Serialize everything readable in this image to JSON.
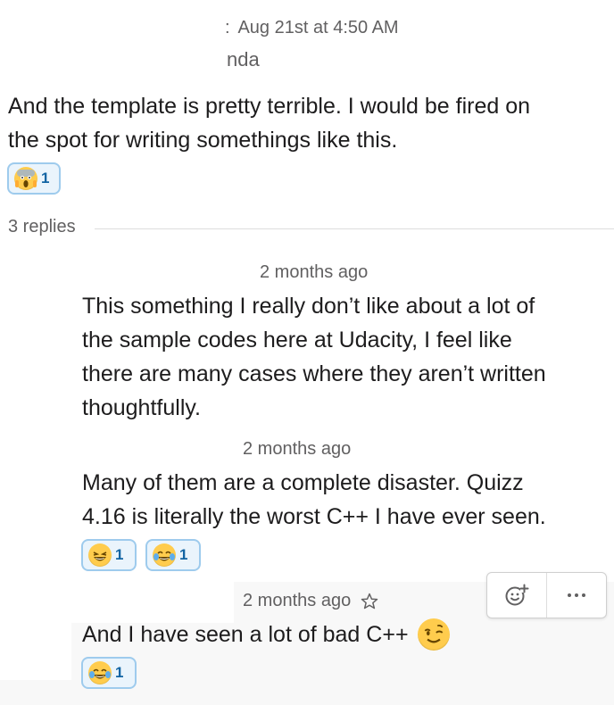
{
  "parent_message": {
    "timestamp": "Aug 21st at 4:50 AM",
    "author_fragment": "nda",
    "text_line1": "And the template is pretty terrible. I would be fired on",
    "text_line2": "the spot for writing somethings like this.",
    "reactions": [
      {
        "emoji": "scream-emoji",
        "count": "1"
      }
    ]
  },
  "thread": {
    "replies_label": "3 replies",
    "replies": [
      {
        "timestamp": "2 months ago",
        "lines": [
          "This something I really don’t like about a lot of",
          "the sample codes here at Udacity, I feel like",
          "there are many cases where they aren’t written",
          "thoughtfully."
        ],
        "reactions": []
      },
      {
        "timestamp": "2 months ago",
        "lines": [
          "Many of them are a complete disaster. Quizz",
          "4.16 is literally the worst C++ I have ever seen."
        ],
        "reactions": [
          {
            "emoji": "laughing-emoji",
            "count": "1"
          },
          {
            "emoji": "joy-emoji",
            "count": "1"
          }
        ]
      },
      {
        "timestamp": "2 months ago",
        "lines": [
          "And I have seen a lot of bad C++"
        ],
        "inline_emoji": "wink-emoji",
        "reactions": [
          {
            "emoji": "joy-emoji",
            "count": "1"
          }
        ]
      }
    ]
  },
  "colors": {
    "reaction_border": "#9ecbed",
    "reaction_bg": "#eaf4fc",
    "reaction_count": "#1264a3",
    "muted_text": "#616061",
    "hover_bg": "#f8f8f8"
  },
  "icons": {
    "add_reaction": "add-reaction-icon",
    "more_actions": "more-actions-icon",
    "star": "star-icon"
  }
}
